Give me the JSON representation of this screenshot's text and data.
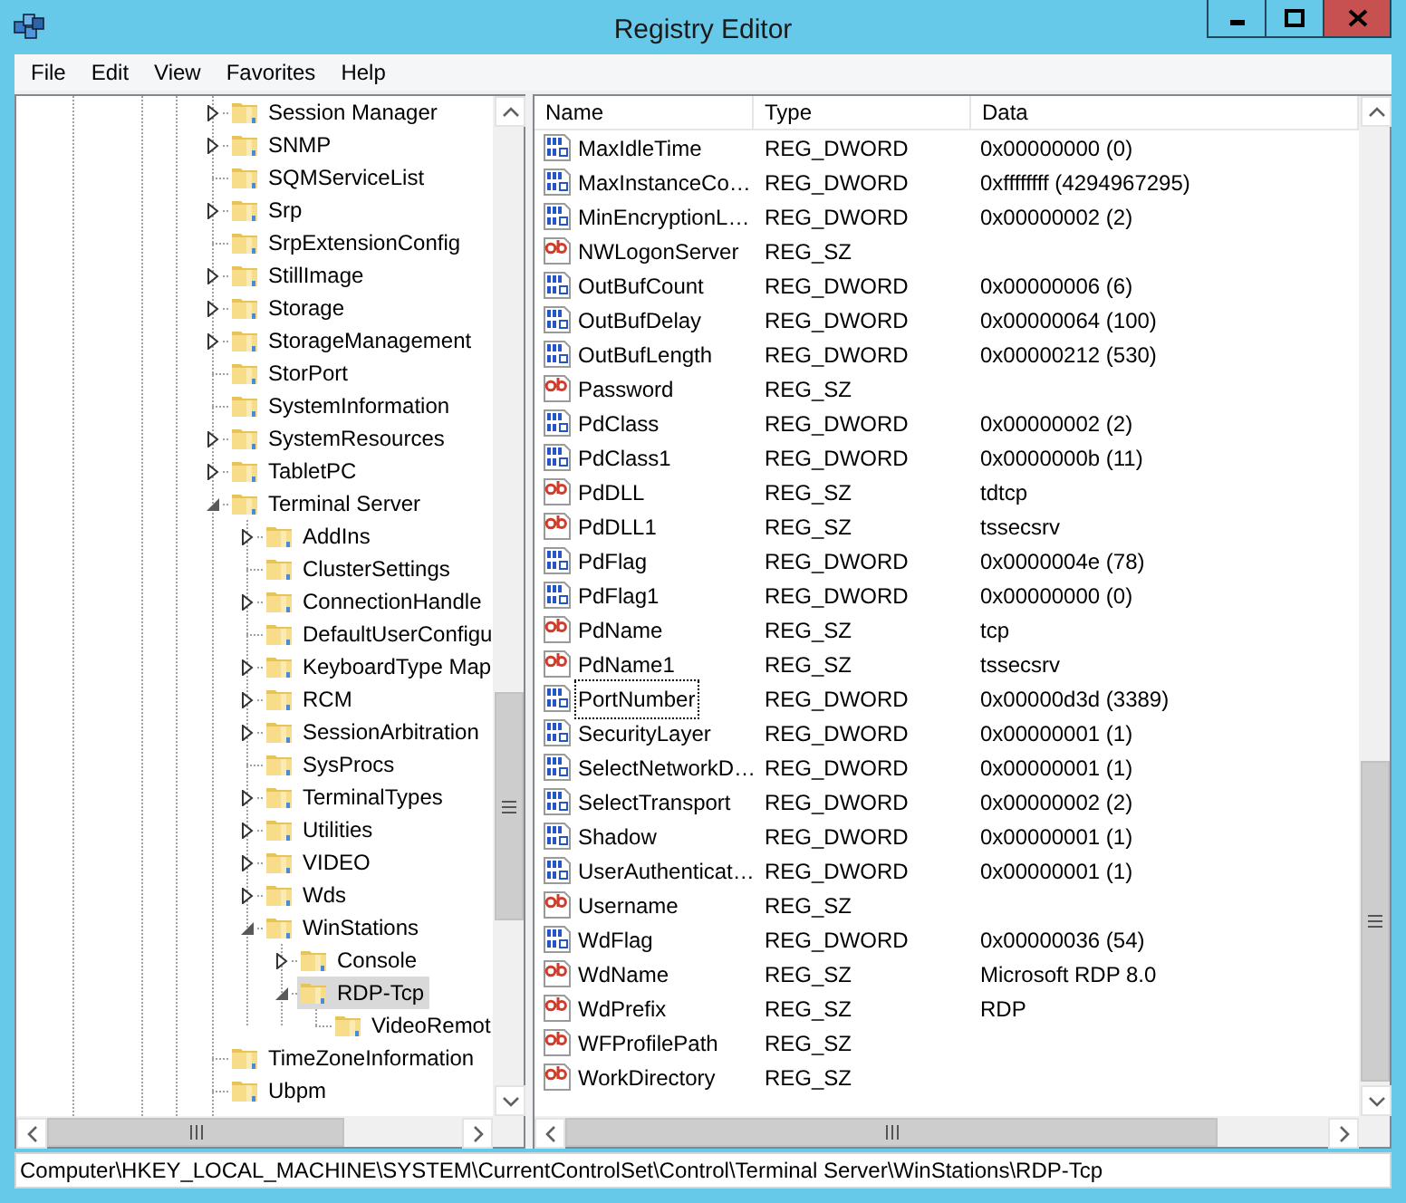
{
  "window": {
    "title": "Registry Editor"
  },
  "menu": [
    "File",
    "Edit",
    "View",
    "Favorites",
    "Help"
  ],
  "tree": {
    "items": [
      {
        "label": "Session Manager",
        "expanded": false,
        "selected": false
      },
      {
        "label": "SNMP",
        "expanded": false,
        "selected": false
      },
      {
        "label": "SQMServiceList",
        "selected": false
      },
      {
        "label": "Srp",
        "expanded": false,
        "selected": false
      },
      {
        "label": "SrpExtensionConfig",
        "selected": false
      },
      {
        "label": "StillImage",
        "expanded": false,
        "selected": false
      },
      {
        "label": "Storage",
        "expanded": false,
        "selected": false
      },
      {
        "label": "StorageManagement",
        "expanded": false,
        "selected": false
      },
      {
        "label": "StorPort",
        "selected": false
      },
      {
        "label": "SystemInformation",
        "selected": false
      },
      {
        "label": "SystemResources",
        "expanded": false,
        "selected": false
      },
      {
        "label": "TabletPC",
        "expanded": false,
        "selected": false
      },
      {
        "label": "Terminal Server",
        "expanded": true,
        "selected": false,
        "children": [
          {
            "label": "AddIns",
            "expanded": false,
            "selected": false
          },
          {
            "label": "ClusterSettings",
            "selected": false
          },
          {
            "label": "ConnectionHandle",
            "expanded": false,
            "selected": false
          },
          {
            "label": "DefaultUserConfigu",
            "selected": false
          },
          {
            "label": "KeyboardType Map",
            "expanded": false,
            "selected": false
          },
          {
            "label": "RCM",
            "expanded": false,
            "selected": false
          },
          {
            "label": "SessionArbitration",
            "expanded": false,
            "selected": false
          },
          {
            "label": "SysProcs",
            "selected": false
          },
          {
            "label": "TerminalTypes",
            "expanded": false,
            "selected": false
          },
          {
            "label": "Utilities",
            "expanded": false,
            "selected": false
          },
          {
            "label": "VIDEO",
            "expanded": false,
            "selected": false
          },
          {
            "label": "Wds",
            "expanded": false,
            "selected": false
          },
          {
            "label": "WinStations",
            "expanded": true,
            "selected": false,
            "children": [
              {
                "label": "Console",
                "expanded": false,
                "selected": false
              },
              {
                "label": "RDP-Tcp",
                "expanded": true,
                "selected": true,
                "children": [
                  {
                    "label": "VideoRemot",
                    "selected": false
                  }
                ]
              }
            ]
          }
        ]
      },
      {
        "label": "TimeZoneInformation",
        "selected": false
      },
      {
        "label": "Ubpm",
        "selected": false
      }
    ]
  },
  "list": {
    "columns": [
      "Name",
      "Type",
      "Data"
    ],
    "rows": [
      {
        "kind": "dword",
        "name": "MaxIdleTime",
        "type": "REG_DWORD",
        "data": "0x00000000 (0)",
        "selected": false
      },
      {
        "kind": "dword",
        "name": "MaxInstanceCo…",
        "type": "REG_DWORD",
        "data": "0xffffffff (4294967295)",
        "selected": false
      },
      {
        "kind": "dword",
        "name": "MinEncryptionL…",
        "type": "REG_DWORD",
        "data": "0x00000002 (2)",
        "selected": false
      },
      {
        "kind": "string",
        "name": "NWLogonServer",
        "type": "REG_SZ",
        "selected": false
      },
      {
        "kind": "dword",
        "name": "OutBufCount",
        "type": "REG_DWORD",
        "data": "0x00000006 (6)",
        "selected": false
      },
      {
        "kind": "dword",
        "name": "OutBufDelay",
        "type": "REG_DWORD",
        "data": "0x00000064 (100)",
        "selected": false
      },
      {
        "kind": "dword",
        "name": "OutBufLength",
        "type": "REG_DWORD",
        "data": "0x00000212 (530)",
        "selected": false
      },
      {
        "kind": "string",
        "name": "Password",
        "type": "REG_SZ",
        "selected": false
      },
      {
        "kind": "dword",
        "name": "PdClass",
        "type": "REG_DWORD",
        "data": "0x00000002 (2)",
        "selected": false
      },
      {
        "kind": "dword",
        "name": "PdClass1",
        "type": "REG_DWORD",
        "data": "0x0000000b (11)",
        "selected": false
      },
      {
        "kind": "string",
        "name": "PdDLL",
        "type": "REG_SZ",
        "data": "tdtcp",
        "selected": false
      },
      {
        "kind": "string",
        "name": "PdDLL1",
        "type": "REG_SZ",
        "data": "tssecsrv",
        "selected": false
      },
      {
        "kind": "dword",
        "name": "PdFlag",
        "type": "REG_DWORD",
        "data": "0x0000004e (78)",
        "selected": false
      },
      {
        "kind": "dword",
        "name": "PdFlag1",
        "type": "REG_DWORD",
        "data": "0x00000000 (0)",
        "selected": false
      },
      {
        "kind": "string",
        "name": "PdName",
        "type": "REG_SZ",
        "data": "tcp",
        "selected": false
      },
      {
        "kind": "string",
        "name": "PdName1",
        "type": "REG_SZ",
        "data": "tssecsrv",
        "selected": false
      },
      {
        "kind": "dword",
        "name": "PortNumber",
        "type": "REG_DWORD",
        "data": "0x00000d3d (3389)",
        "selected": true
      },
      {
        "kind": "dword",
        "name": "SecurityLayer",
        "type": "REG_DWORD",
        "data": "0x00000001 (1)",
        "selected": false
      },
      {
        "kind": "dword",
        "name": "SelectNetworkD…",
        "type": "REG_DWORD",
        "data": "0x00000001 (1)",
        "selected": false
      },
      {
        "kind": "dword",
        "name": "SelectTransport",
        "type": "REG_DWORD",
        "data": "0x00000002 (2)",
        "selected": false
      },
      {
        "kind": "dword",
        "name": "Shadow",
        "type": "REG_DWORD",
        "data": "0x00000001 (1)",
        "selected": false
      },
      {
        "kind": "dword",
        "name": "UserAuthenticat…",
        "type": "REG_DWORD",
        "data": "0x00000001 (1)",
        "selected": false
      },
      {
        "kind": "string",
        "name": "Username",
        "type": "REG_SZ",
        "selected": false
      },
      {
        "kind": "dword",
        "name": "WdFlag",
        "type": "REG_DWORD",
        "data": "0x00000036 (54)",
        "selected": false
      },
      {
        "kind": "string",
        "name": "WdName",
        "type": "REG_SZ",
        "data": "Microsoft RDP 8.0",
        "selected": false
      },
      {
        "kind": "string",
        "name": "WdPrefix",
        "type": "REG_SZ",
        "data": "RDP",
        "selected": false
      },
      {
        "kind": "string",
        "name": "WFProfilePath",
        "type": "REG_SZ",
        "selected": false
      },
      {
        "kind": "string",
        "name": "WorkDirectory",
        "type": "REG_SZ",
        "selected": false
      }
    ]
  },
  "status_bar": "Computer\\HKEY_LOCAL_MACHINE\\SYSTEM\\CurrentControlSet\\Control\\Terminal Server\\WinStations\\RDP-Tcp"
}
